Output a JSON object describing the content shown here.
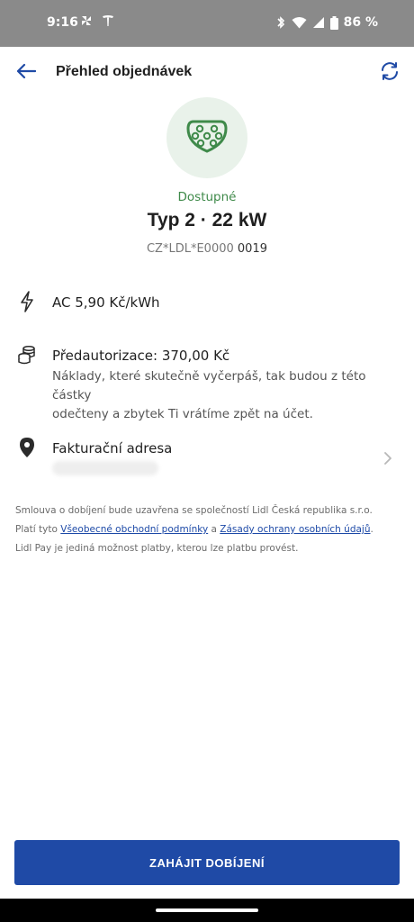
{
  "status_bar": {
    "time": "9:16",
    "battery": "86 %",
    "icons": [
      "pinwheel-icon",
      "tesla-icon",
      "bluetooth-icon",
      "wifi-icon",
      "signal-icon",
      "battery-icon"
    ]
  },
  "header": {
    "title": "Přehled objednávek",
    "back_icon": "back-arrow-icon",
    "refresh_icon": "refresh-icon"
  },
  "connector": {
    "icon": "type2-connector-icon",
    "status": "Dostupné",
    "title": "Typ 2 · 22 kW",
    "evse_prefix": "CZ*LDL*E0000",
    "evse_number": "0019"
  },
  "price": {
    "icon": "lightning-icon",
    "text": "AC  5,90 Kč/kWh"
  },
  "preauth": {
    "icon": "coins-icon",
    "title": "Předautorizace: 370,00 Kč",
    "description_line1": "Náklady, které skutečně vyčerpáš, tak budou z této částky",
    "description_line2": "odečteny a zbytek Ti vrátíme zpět na účet."
  },
  "billing": {
    "icon": "location-pin-icon",
    "title": "Fakturační adresa",
    "chevron_icon": "chevron-right-icon"
  },
  "legal": {
    "line1": "Smlouva o dobíjení bude uzavřena se společností Lidl Česká republika s.r.o.",
    "line2_prefix": "Platí tyto",
    "terms_link": "Všeobecné obchodní podmínky",
    "line2_and": "a",
    "privacy_link": "Zásady ochrany osobních údajů",
    "line2_suffix": ".",
    "line3": "Lidl Pay je jediná možnost platby, kterou lze platbu provést."
  },
  "cta": {
    "label": "ZAHÁJIT DOBÍJENÍ"
  },
  "colors": {
    "accent": "#1f4aa6",
    "status_green": "#3f8a4a",
    "connector_bg": "#e9f2ea",
    "status_bar": "#8a8a8a"
  }
}
